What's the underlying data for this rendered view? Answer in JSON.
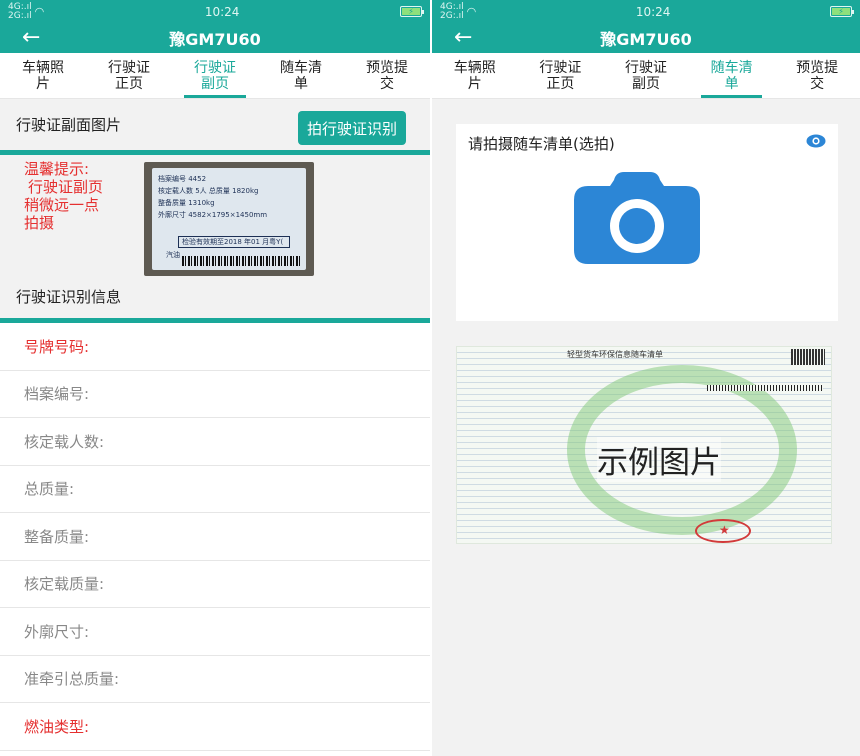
{
  "left": {
    "status": {
      "signal": "4G:.ıl",
      "signal2": "2G:.ıl",
      "time": "10:24"
    },
    "title": "豫GM7U60",
    "tabs": [
      "车辆照\n片",
      "行驶证\n正页",
      "行驶证\n副页",
      "随车清\n单",
      "预览提\n交"
    ],
    "active_tab": 2,
    "section_title": "行驶证副面图片",
    "recognize_button": "拍行驶证识别",
    "tip": {
      "line1": "温馨提示:",
      "line2": "行驶证副页",
      "line3": "稍微远一点",
      "line4": "拍摄"
    },
    "license_image": {
      "row1": "档案编号  4452",
      "row2": "核定载人数 5人     总质量  1820kg",
      "row3": "整备质量 1310kg",
      "row4": "外廓尺寸 4582×1795×1450mm",
      "stamp": "检验有效期至2018 年01 月粤Y(",
      "fuel": "汽油"
    },
    "info_title": "行驶证识别信息",
    "fields": [
      {
        "label": "号牌号码:",
        "required": true
      },
      {
        "label": "档案编号:",
        "required": false
      },
      {
        "label": "核定载人数:",
        "required": false
      },
      {
        "label": "总质量:",
        "required": false
      },
      {
        "label": "整备质量:",
        "required": false
      },
      {
        "label": "核定载质量:",
        "required": false
      },
      {
        "label": "外廓尺寸:",
        "required": false
      },
      {
        "label": "准牵引总质量:",
        "required": false
      },
      {
        "label": "燃油类型:",
        "required": true
      }
    ]
  },
  "right": {
    "status": {
      "signal": "4G:.ıl",
      "signal2": "2G:.ıl",
      "time": "10:24"
    },
    "title": "豫GM7U60",
    "tabs": [
      "车辆照\n片",
      "行驶证\n正页",
      "行驶证\n副页",
      "随车清\n单",
      "预览提\n交"
    ],
    "active_tab": 3,
    "upload_label": "请拍摄随车清单(选拍)",
    "sample_header": "轻型货车环保信息随车清单",
    "sample_label": "示例图片"
  },
  "colors": {
    "primary": "#1aa89a",
    "required": "#e53030",
    "camera": "#2c86d6"
  },
  "icons": {
    "back": "arrow-left-icon",
    "camera": "camera-icon",
    "eye": "eye-icon",
    "battery": "battery-icon"
  }
}
